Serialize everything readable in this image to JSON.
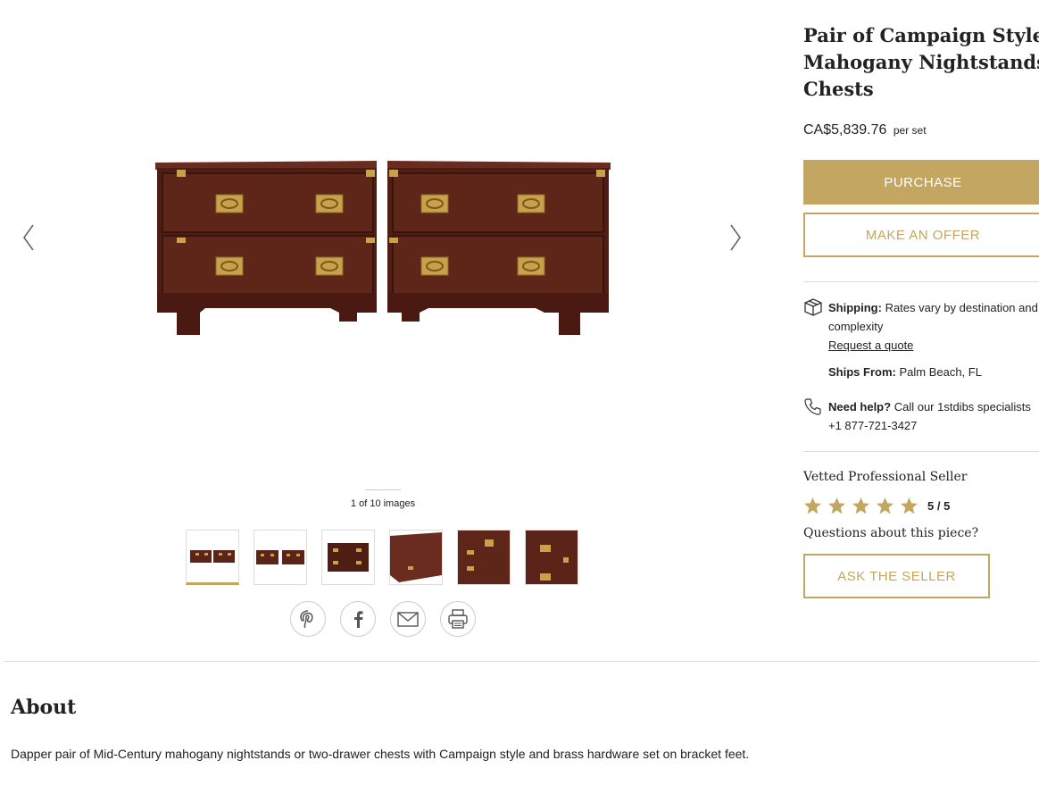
{
  "product": {
    "title_lines": [
      "Pair of Campaign Style",
      "Mahogany Nightstands or",
      "Chests"
    ],
    "price": "CA$5,839.76",
    "price_unit": "per set",
    "purchase_label": "PURCHASE",
    "offer_label": "MAKE AN OFFER"
  },
  "gallery": {
    "counter": "1 of 10 images",
    "thumbnail_count": 6,
    "active_thumbnail": 1,
    "share_icons": [
      "pinterest-icon",
      "facebook-icon",
      "email-icon",
      "print-icon"
    ]
  },
  "shipping": {
    "label": "Shipping:",
    "text": "Rates vary by destination and complexity",
    "link": "Request a quote",
    "ships_from_label": "Ships From:",
    "ships_from": "Palm Beach, FL"
  },
  "help": {
    "label": "Need help?",
    "text": "Call our 1stdibs specialists +1 877-721-3427"
  },
  "seller": {
    "vetted": "Vetted Professional Seller",
    "rating": "5 / 5",
    "rating_value": 5,
    "rating_max": 5,
    "questions": "Questions about this piece?",
    "ask_label": "ASK THE SELLER"
  },
  "about": {
    "title": "About",
    "text": "Dapper pair of Mid-Century mahogany nightstands or two-drawer chests with Campaign style and brass hardware set on bracket feet."
  },
  "colors": {
    "accent": "#c2a661",
    "wood": "#5a2418",
    "brass": "#c9a14a"
  }
}
